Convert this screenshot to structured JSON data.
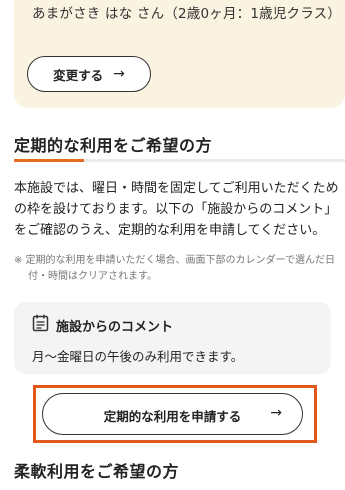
{
  "child_card": {
    "name_text": "あまがさき はな さん（2歳0ヶ月：1歳児クラス）",
    "change_button": "変更する"
  },
  "regular": {
    "title": "定期的な利用をご希望の方",
    "description": "本施設では、曜日・時間を固定してご利用いただくための枠を設けております。以下の「施設からのコメント」をご確認のうえ、定期的な利用を申請してください。",
    "note": "※ 定期的な利用を申請いただく場合、画面下部のカレンダーで選んだ日付・時間はクリアされます。",
    "comment": {
      "heading": "施設からのコメント",
      "body": "月〜金曜日の午後のみ利用できます。"
    },
    "apply_button": "定期的な利用を申請する"
  },
  "flexible": {
    "title": "柔軟利用をご希望の方"
  },
  "arrow_glyph": "→",
  "colors": {
    "card_bg": "#fbf3e2",
    "accent": "#e46b20",
    "highlight": "#e2591e",
    "comment_bg": "#f4f4f4"
  },
  "icons": {
    "comment": "memo-icon",
    "arrow": "arrow-right-icon"
  }
}
